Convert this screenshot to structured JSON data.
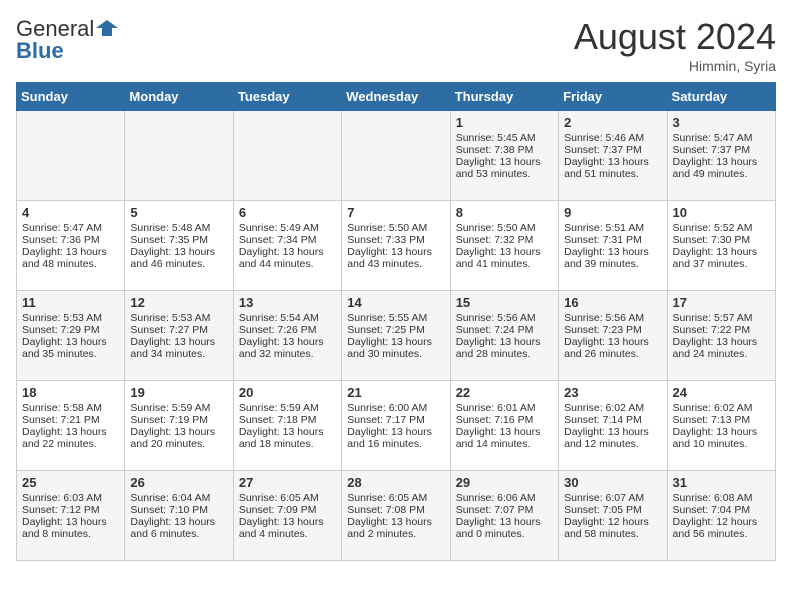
{
  "header": {
    "logo_general": "General",
    "logo_blue": "Blue",
    "month_title": "August 2024",
    "location": "Himmin, Syria"
  },
  "days_of_week": [
    "Sunday",
    "Monday",
    "Tuesday",
    "Wednesday",
    "Thursday",
    "Friday",
    "Saturday"
  ],
  "weeks": [
    [
      {
        "day": "",
        "content": ""
      },
      {
        "day": "",
        "content": ""
      },
      {
        "day": "",
        "content": ""
      },
      {
        "day": "",
        "content": ""
      },
      {
        "day": "1",
        "content": "Sunrise: 5:45 AM\nSunset: 7:38 PM\nDaylight: 13 hours\nand 53 minutes."
      },
      {
        "day": "2",
        "content": "Sunrise: 5:46 AM\nSunset: 7:37 PM\nDaylight: 13 hours\nand 51 minutes."
      },
      {
        "day": "3",
        "content": "Sunrise: 5:47 AM\nSunset: 7:37 PM\nDaylight: 13 hours\nand 49 minutes."
      }
    ],
    [
      {
        "day": "4",
        "content": "Sunrise: 5:47 AM\nSunset: 7:36 PM\nDaylight: 13 hours\nand 48 minutes."
      },
      {
        "day": "5",
        "content": "Sunrise: 5:48 AM\nSunset: 7:35 PM\nDaylight: 13 hours\nand 46 minutes."
      },
      {
        "day": "6",
        "content": "Sunrise: 5:49 AM\nSunset: 7:34 PM\nDaylight: 13 hours\nand 44 minutes."
      },
      {
        "day": "7",
        "content": "Sunrise: 5:50 AM\nSunset: 7:33 PM\nDaylight: 13 hours\nand 43 minutes."
      },
      {
        "day": "8",
        "content": "Sunrise: 5:50 AM\nSunset: 7:32 PM\nDaylight: 13 hours\nand 41 minutes."
      },
      {
        "day": "9",
        "content": "Sunrise: 5:51 AM\nSunset: 7:31 PM\nDaylight: 13 hours\nand 39 minutes."
      },
      {
        "day": "10",
        "content": "Sunrise: 5:52 AM\nSunset: 7:30 PM\nDaylight: 13 hours\nand 37 minutes."
      }
    ],
    [
      {
        "day": "11",
        "content": "Sunrise: 5:53 AM\nSunset: 7:29 PM\nDaylight: 13 hours\nand 35 minutes."
      },
      {
        "day": "12",
        "content": "Sunrise: 5:53 AM\nSunset: 7:27 PM\nDaylight: 13 hours\nand 34 minutes."
      },
      {
        "day": "13",
        "content": "Sunrise: 5:54 AM\nSunset: 7:26 PM\nDaylight: 13 hours\nand 32 minutes."
      },
      {
        "day": "14",
        "content": "Sunrise: 5:55 AM\nSunset: 7:25 PM\nDaylight: 13 hours\nand 30 minutes."
      },
      {
        "day": "15",
        "content": "Sunrise: 5:56 AM\nSunset: 7:24 PM\nDaylight: 13 hours\nand 28 minutes."
      },
      {
        "day": "16",
        "content": "Sunrise: 5:56 AM\nSunset: 7:23 PM\nDaylight: 13 hours\nand 26 minutes."
      },
      {
        "day": "17",
        "content": "Sunrise: 5:57 AM\nSunset: 7:22 PM\nDaylight: 13 hours\nand 24 minutes."
      }
    ],
    [
      {
        "day": "18",
        "content": "Sunrise: 5:58 AM\nSunset: 7:21 PM\nDaylight: 13 hours\nand 22 minutes."
      },
      {
        "day": "19",
        "content": "Sunrise: 5:59 AM\nSunset: 7:19 PM\nDaylight: 13 hours\nand 20 minutes."
      },
      {
        "day": "20",
        "content": "Sunrise: 5:59 AM\nSunset: 7:18 PM\nDaylight: 13 hours\nand 18 minutes."
      },
      {
        "day": "21",
        "content": "Sunrise: 6:00 AM\nSunset: 7:17 PM\nDaylight: 13 hours\nand 16 minutes."
      },
      {
        "day": "22",
        "content": "Sunrise: 6:01 AM\nSunset: 7:16 PM\nDaylight: 13 hours\nand 14 minutes."
      },
      {
        "day": "23",
        "content": "Sunrise: 6:02 AM\nSunset: 7:14 PM\nDaylight: 13 hours\nand 12 minutes."
      },
      {
        "day": "24",
        "content": "Sunrise: 6:02 AM\nSunset: 7:13 PM\nDaylight: 13 hours\nand 10 minutes."
      }
    ],
    [
      {
        "day": "25",
        "content": "Sunrise: 6:03 AM\nSunset: 7:12 PM\nDaylight: 13 hours\nand 8 minutes."
      },
      {
        "day": "26",
        "content": "Sunrise: 6:04 AM\nSunset: 7:10 PM\nDaylight: 13 hours\nand 6 minutes."
      },
      {
        "day": "27",
        "content": "Sunrise: 6:05 AM\nSunset: 7:09 PM\nDaylight: 13 hours\nand 4 minutes."
      },
      {
        "day": "28",
        "content": "Sunrise: 6:05 AM\nSunset: 7:08 PM\nDaylight: 13 hours\nand 2 minutes."
      },
      {
        "day": "29",
        "content": "Sunrise: 6:06 AM\nSunset: 7:07 PM\nDaylight: 13 hours\nand 0 minutes."
      },
      {
        "day": "30",
        "content": "Sunrise: 6:07 AM\nSunset: 7:05 PM\nDaylight: 12 hours\nand 58 minutes."
      },
      {
        "day": "31",
        "content": "Sunrise: 6:08 AM\nSunset: 7:04 PM\nDaylight: 12 hours\nand 56 minutes."
      }
    ]
  ]
}
